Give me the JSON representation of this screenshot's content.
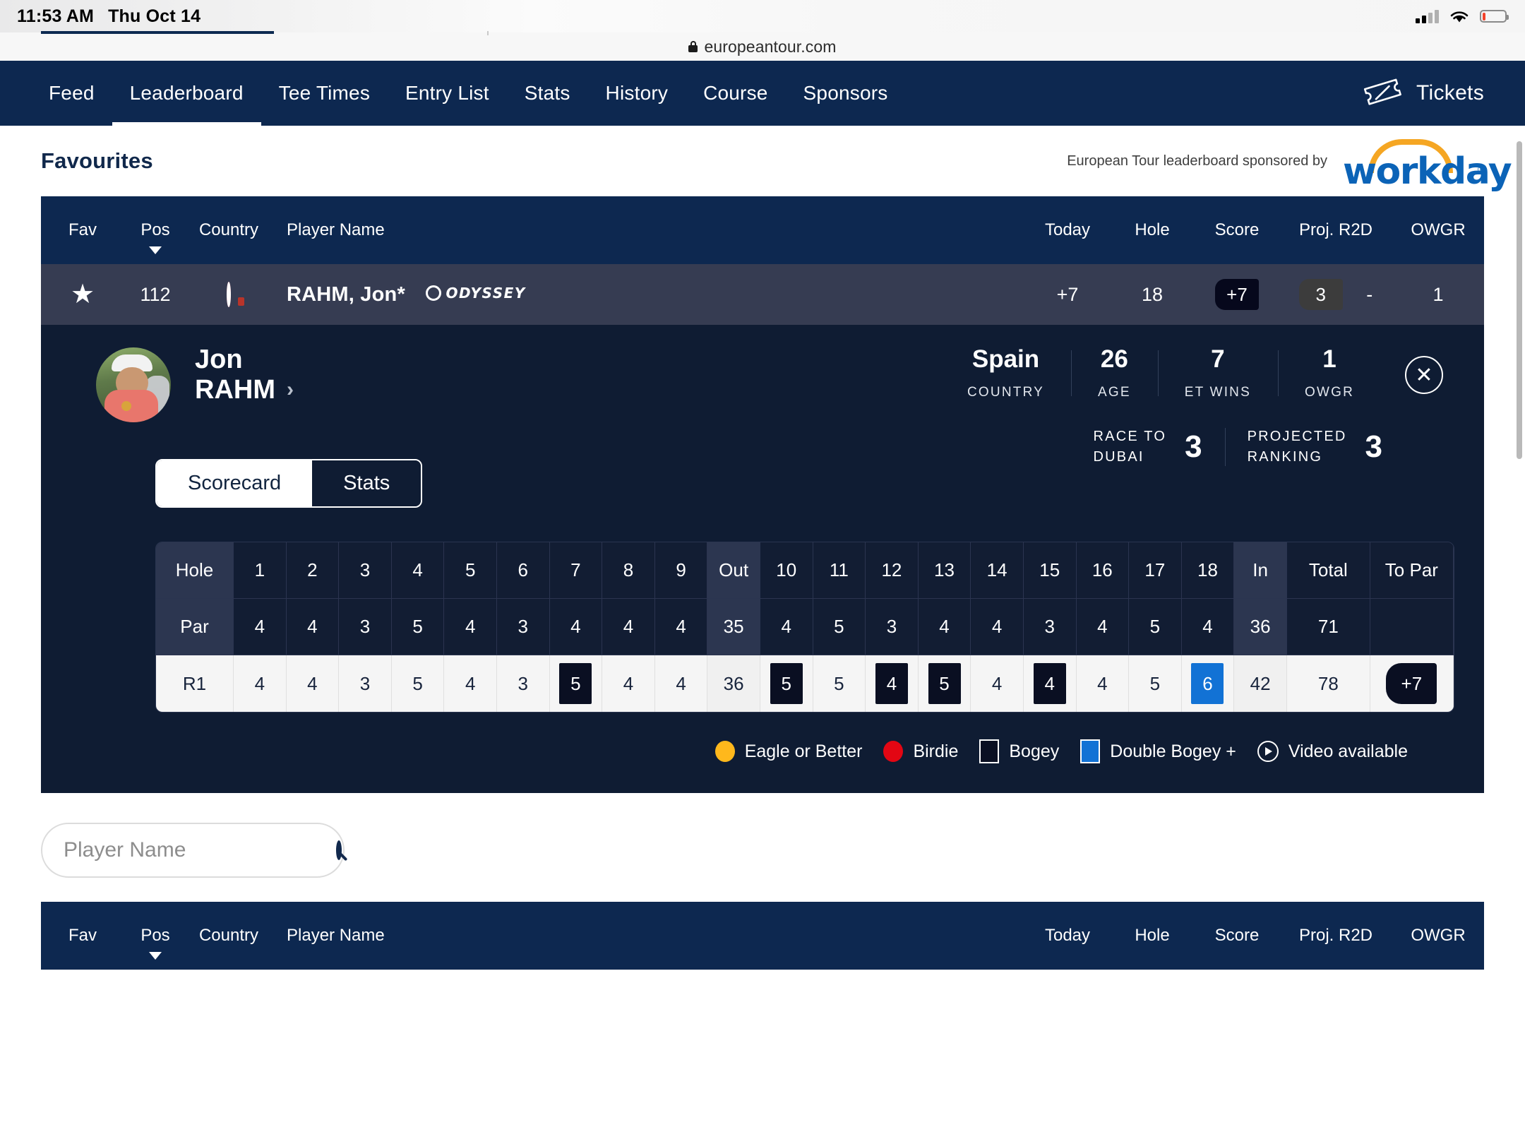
{
  "status_bar": {
    "time": "11:53 AM",
    "date": "Thu Oct 14"
  },
  "browser": {
    "url": "europeantour.com",
    "lock_icon": "lock-icon"
  },
  "nav": {
    "items": [
      {
        "label": "Feed",
        "active": false
      },
      {
        "label": "Leaderboard",
        "active": true
      },
      {
        "label": "Tee Times",
        "active": false
      },
      {
        "label": "Entry List",
        "active": false
      },
      {
        "label": "Stats",
        "active": false
      },
      {
        "label": "History",
        "active": false
      },
      {
        "label": "Course",
        "active": false
      },
      {
        "label": "Sponsors",
        "active": false
      }
    ],
    "tickets_label": "Tickets",
    "tickets_icon": "ticket-icon",
    "background": "#0d2850"
  },
  "favourites": {
    "title": "Favourites",
    "sponsor_text": "European Tour leaderboard sponsored by",
    "sponsor_logo": "workday",
    "sponsor_arc_color": "#f5a623",
    "sponsor_word_color": "#0b63b7",
    "sponsor_reg": "®"
  },
  "leaderboard_header": {
    "fav": "Fav",
    "pos": "Pos",
    "country": "Country",
    "player_name": "Player Name",
    "today": "Today",
    "hole": "Hole",
    "score": "Score",
    "proj_r2d": "Proj. R2D",
    "owgr": "OWGR",
    "sort_icon": "caret-down-icon"
  },
  "player_row": {
    "fav_icon": "star-filled-icon",
    "pos": "112",
    "country_flag": "spain-flag-icon",
    "name": "RAHM, Jon*",
    "sponsor_brand": "ODYSSEY",
    "today": "+7",
    "hole": "18",
    "score": "+7",
    "proj_r2d": "3",
    "r2d_change": "-",
    "owgr": "1"
  },
  "player_detail": {
    "avatar": "player-photo",
    "first_name": "Jon",
    "last_name": "RAHM",
    "chevron": "›",
    "stats": [
      {
        "value": "Spain",
        "label": "COUNTRY"
      },
      {
        "value": "26",
        "label": "AGE"
      },
      {
        "value": "7",
        "label": "ET WINS"
      },
      {
        "value": "1",
        "label": "OWGR"
      }
    ],
    "close_icon": "close-circle-icon",
    "rankings": [
      {
        "label_line1": "RACE TO",
        "label_line2": "DUBAI",
        "value": "3"
      },
      {
        "label_line1": "PROJECTED",
        "label_line2": "RANKING",
        "value": "3"
      }
    ],
    "tabs": {
      "scorecard": "Scorecard",
      "stats": "Stats",
      "active": "Scorecard"
    }
  },
  "chart_data": {
    "type": "table",
    "title": "Jon Rahm Round 1 Scorecard",
    "row_labels": [
      "Hole",
      "Par",
      "R1"
    ],
    "categories": [
      "1",
      "2",
      "3",
      "4",
      "5",
      "6",
      "7",
      "8",
      "9",
      "Out",
      "10",
      "11",
      "12",
      "13",
      "14",
      "15",
      "16",
      "17",
      "18",
      "In",
      "Total",
      "To Par"
    ],
    "series": [
      {
        "name": "Par",
        "values": [
          "4",
          "4",
          "3",
          "5",
          "4",
          "3",
          "4",
          "4",
          "4",
          "35",
          "4",
          "5",
          "3",
          "4",
          "4",
          "3",
          "4",
          "5",
          "4",
          "36",
          "71",
          ""
        ]
      },
      {
        "name": "R1",
        "values": [
          "4",
          "4",
          "3",
          "5",
          "4",
          "3",
          "5",
          "4",
          "4",
          "36",
          "5",
          "5",
          "4",
          "5",
          "4",
          "4",
          "4",
          "5",
          "6",
          "42",
          "78",
          "+7"
        ]
      }
    ],
    "marks": {
      "R1": [
        "",
        "",
        "",
        "",
        "",
        "",
        "bogey",
        "",
        "",
        "",
        "bogey",
        "",
        "bogey",
        "bogey",
        "",
        "bogey",
        "",
        "",
        "dbogey",
        "",
        "",
        "topar"
      ]
    }
  },
  "scorecard": {
    "columns": [
      "Hole",
      "1",
      "2",
      "3",
      "4",
      "5",
      "6",
      "7",
      "8",
      "9",
      "Out",
      "10",
      "11",
      "12",
      "13",
      "14",
      "15",
      "16",
      "17",
      "18",
      "In",
      "Total",
      "To Par"
    ],
    "par_label": "Par",
    "par": [
      "4",
      "4",
      "3",
      "5",
      "4",
      "3",
      "4",
      "4",
      "4",
      "35",
      "4",
      "5",
      "3",
      "4",
      "4",
      "3",
      "4",
      "5",
      "4",
      "36",
      "71",
      ""
    ],
    "r1_label": "R1",
    "r1": [
      "4",
      "4",
      "3",
      "5",
      "4",
      "3",
      "5",
      "4",
      "4",
      "36",
      "5",
      "5",
      "4",
      "5",
      "4",
      "4",
      "4",
      "5",
      "6",
      "42",
      "78",
      "+7"
    ],
    "r1_marks": [
      "",
      "",
      "",
      "",
      "",
      "",
      "bogey",
      "",
      "",
      "",
      "bogey",
      "",
      "bogey",
      "bogey",
      "",
      "bogey",
      "",
      "",
      "dbogey",
      "",
      "",
      "topar"
    ]
  },
  "legend": [
    {
      "label": "Eagle or Better",
      "icon": "circle-icon",
      "color": "#ffb81c",
      "shape": "dot-eagle"
    },
    {
      "label": "Birdie",
      "icon": "circle-icon",
      "color": "#e30613",
      "shape": "dot-birdie"
    },
    {
      "label": "Bogey",
      "icon": "square-icon",
      "color": "#0a0f22",
      "shape": "sq-bogey"
    },
    {
      "label": "Double Bogey +",
      "icon": "square-icon",
      "color": "#1272d5",
      "shape": "sq-dbl"
    },
    {
      "label": "Video available",
      "icon": "play-circle-icon",
      "color": "#ffffff",
      "shape": "play"
    }
  ],
  "search": {
    "placeholder": "Player Name",
    "value": "",
    "icon": "search-icon"
  },
  "leaderboard_header_2": {
    "fav": "Fav",
    "pos": "Pos",
    "country": "Country",
    "player_name": "Player Name",
    "today": "Today",
    "hole": "Hole",
    "score": "Score",
    "proj_r2d": "Proj. R2D",
    "owgr": "OWGR"
  }
}
